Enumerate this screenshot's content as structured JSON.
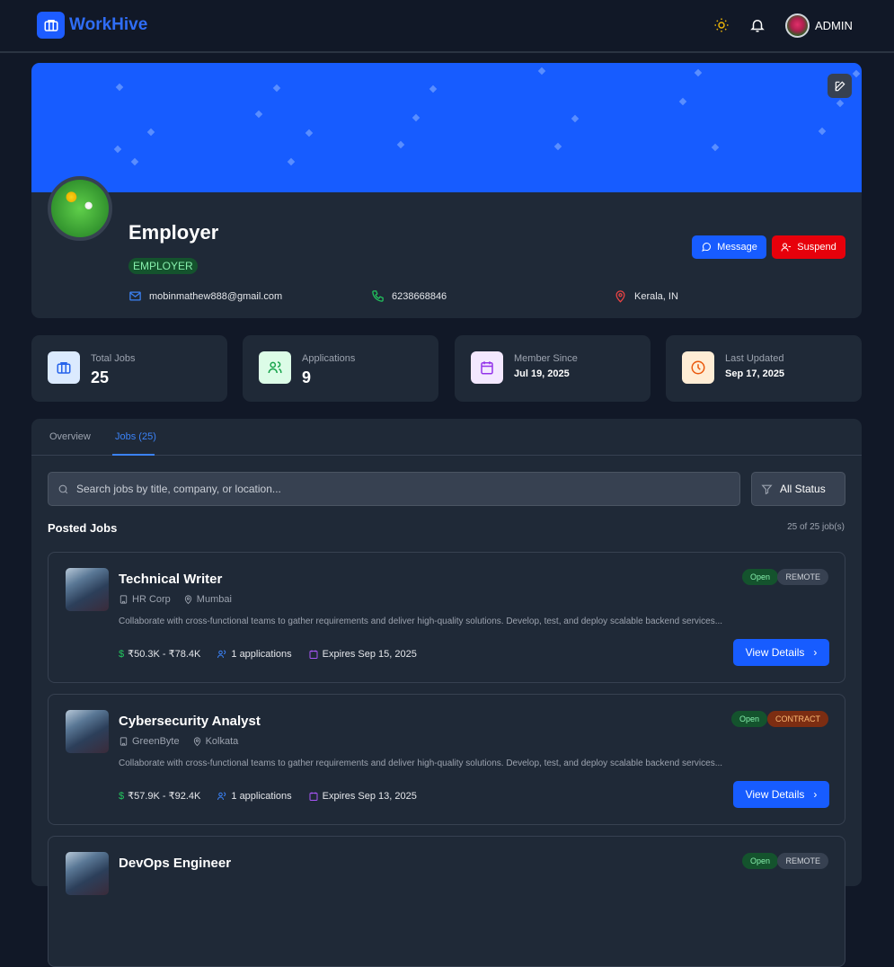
{
  "header": {
    "brand": "WorkHive",
    "user": "ADMIN",
    "icons": [
      "briefcase-icon",
      "sun-icon",
      "bell-icon"
    ]
  },
  "profile": {
    "name": "Employer",
    "role": "EMPLOYER",
    "email": "mobinmathew888@gmail.com",
    "phone": "6238668846",
    "location": "Kerala, IN",
    "message_label": "Message",
    "suspend_label": "Suspend",
    "colors": {
      "banner": "#175cff",
      "suspend": "#e7000b"
    }
  },
  "stats": [
    {
      "label": "Total Jobs",
      "value": "25"
    },
    {
      "label": "Applications",
      "value": "9"
    },
    {
      "label": "Member Since",
      "value": "Jul 19, 2025"
    },
    {
      "label": "Last Updated",
      "value": "Sep 17, 2025"
    }
  ],
  "tabs": [
    {
      "label": "Overview",
      "active": false
    },
    {
      "label": "Jobs (25)",
      "active": true
    }
  ],
  "search": {
    "placeholder": "Search jobs by title, company, or location...",
    "value": ""
  },
  "filter": {
    "selected": "All Status"
  },
  "posted": {
    "title": "Posted Jobs",
    "count": "25 of 25 job(s)"
  },
  "jobs": [
    {
      "title": "Technical Writer",
      "company": "HR Corp",
      "location": "Mumbai",
      "description": "Collaborate with cross-functional teams to gather requirements and deliver high-quality solutions. Develop, test, and deploy scalable backend services...",
      "salary": "₹50.3K - ₹78.4K",
      "applications": "1 applications",
      "expires": "Expires Sep 15, 2025",
      "status": "Open",
      "type": "REMOTE",
      "action": "View Details"
    },
    {
      "title": "Cybersecurity Analyst",
      "company": "GreenByte",
      "location": "Kolkata",
      "description": "Collaborate with cross-functional teams to gather requirements and deliver high-quality solutions. Develop, test, and deploy scalable backend services...",
      "salary": "₹57.9K - ₹92.4K",
      "applications": "1 applications",
      "expires": "Expires Sep 13, 2025",
      "status": "Open",
      "type": "CONTRACT",
      "action": "View Details"
    },
    {
      "title": "DevOps Engineer",
      "status": "Open",
      "type": "REMOTE"
    }
  ]
}
